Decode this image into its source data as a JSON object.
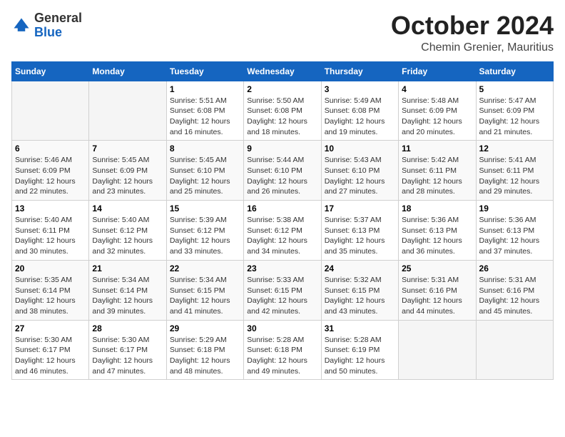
{
  "header": {
    "logo_general": "General",
    "logo_blue": "Blue",
    "month_title": "October 2024",
    "location": "Chemin Grenier, Mauritius"
  },
  "weekdays": [
    "Sunday",
    "Monday",
    "Tuesday",
    "Wednesday",
    "Thursday",
    "Friday",
    "Saturday"
  ],
  "weeks": [
    [
      {
        "day": "",
        "info": ""
      },
      {
        "day": "",
        "info": ""
      },
      {
        "day": "1",
        "info": "Sunrise: 5:51 AM\nSunset: 6:08 PM\nDaylight: 12 hours\nand 16 minutes."
      },
      {
        "day": "2",
        "info": "Sunrise: 5:50 AM\nSunset: 6:08 PM\nDaylight: 12 hours\nand 18 minutes."
      },
      {
        "day": "3",
        "info": "Sunrise: 5:49 AM\nSunset: 6:08 PM\nDaylight: 12 hours\nand 19 minutes."
      },
      {
        "day": "4",
        "info": "Sunrise: 5:48 AM\nSunset: 6:09 PM\nDaylight: 12 hours\nand 20 minutes."
      },
      {
        "day": "5",
        "info": "Sunrise: 5:47 AM\nSunset: 6:09 PM\nDaylight: 12 hours\nand 21 minutes."
      }
    ],
    [
      {
        "day": "6",
        "info": "Sunrise: 5:46 AM\nSunset: 6:09 PM\nDaylight: 12 hours\nand 22 minutes."
      },
      {
        "day": "7",
        "info": "Sunrise: 5:45 AM\nSunset: 6:09 PM\nDaylight: 12 hours\nand 23 minutes."
      },
      {
        "day": "8",
        "info": "Sunrise: 5:45 AM\nSunset: 6:10 PM\nDaylight: 12 hours\nand 25 minutes."
      },
      {
        "day": "9",
        "info": "Sunrise: 5:44 AM\nSunset: 6:10 PM\nDaylight: 12 hours\nand 26 minutes."
      },
      {
        "day": "10",
        "info": "Sunrise: 5:43 AM\nSunset: 6:10 PM\nDaylight: 12 hours\nand 27 minutes."
      },
      {
        "day": "11",
        "info": "Sunrise: 5:42 AM\nSunset: 6:11 PM\nDaylight: 12 hours\nand 28 minutes."
      },
      {
        "day": "12",
        "info": "Sunrise: 5:41 AM\nSunset: 6:11 PM\nDaylight: 12 hours\nand 29 minutes."
      }
    ],
    [
      {
        "day": "13",
        "info": "Sunrise: 5:40 AM\nSunset: 6:11 PM\nDaylight: 12 hours\nand 30 minutes."
      },
      {
        "day": "14",
        "info": "Sunrise: 5:40 AM\nSunset: 6:12 PM\nDaylight: 12 hours\nand 32 minutes."
      },
      {
        "day": "15",
        "info": "Sunrise: 5:39 AM\nSunset: 6:12 PM\nDaylight: 12 hours\nand 33 minutes."
      },
      {
        "day": "16",
        "info": "Sunrise: 5:38 AM\nSunset: 6:12 PM\nDaylight: 12 hours\nand 34 minutes."
      },
      {
        "day": "17",
        "info": "Sunrise: 5:37 AM\nSunset: 6:13 PM\nDaylight: 12 hours\nand 35 minutes."
      },
      {
        "day": "18",
        "info": "Sunrise: 5:36 AM\nSunset: 6:13 PM\nDaylight: 12 hours\nand 36 minutes."
      },
      {
        "day": "19",
        "info": "Sunrise: 5:36 AM\nSunset: 6:13 PM\nDaylight: 12 hours\nand 37 minutes."
      }
    ],
    [
      {
        "day": "20",
        "info": "Sunrise: 5:35 AM\nSunset: 6:14 PM\nDaylight: 12 hours\nand 38 minutes."
      },
      {
        "day": "21",
        "info": "Sunrise: 5:34 AM\nSunset: 6:14 PM\nDaylight: 12 hours\nand 39 minutes."
      },
      {
        "day": "22",
        "info": "Sunrise: 5:34 AM\nSunset: 6:15 PM\nDaylight: 12 hours\nand 41 minutes."
      },
      {
        "day": "23",
        "info": "Sunrise: 5:33 AM\nSunset: 6:15 PM\nDaylight: 12 hours\nand 42 minutes."
      },
      {
        "day": "24",
        "info": "Sunrise: 5:32 AM\nSunset: 6:15 PM\nDaylight: 12 hours\nand 43 minutes."
      },
      {
        "day": "25",
        "info": "Sunrise: 5:31 AM\nSunset: 6:16 PM\nDaylight: 12 hours\nand 44 minutes."
      },
      {
        "day": "26",
        "info": "Sunrise: 5:31 AM\nSunset: 6:16 PM\nDaylight: 12 hours\nand 45 minutes."
      }
    ],
    [
      {
        "day": "27",
        "info": "Sunrise: 5:30 AM\nSunset: 6:17 PM\nDaylight: 12 hours\nand 46 minutes."
      },
      {
        "day": "28",
        "info": "Sunrise: 5:30 AM\nSunset: 6:17 PM\nDaylight: 12 hours\nand 47 minutes."
      },
      {
        "day": "29",
        "info": "Sunrise: 5:29 AM\nSunset: 6:18 PM\nDaylight: 12 hours\nand 48 minutes."
      },
      {
        "day": "30",
        "info": "Sunrise: 5:28 AM\nSunset: 6:18 PM\nDaylight: 12 hours\nand 49 minutes."
      },
      {
        "day": "31",
        "info": "Sunrise: 5:28 AM\nSunset: 6:19 PM\nDaylight: 12 hours\nand 50 minutes."
      },
      {
        "day": "",
        "info": ""
      },
      {
        "day": "",
        "info": ""
      }
    ]
  ]
}
